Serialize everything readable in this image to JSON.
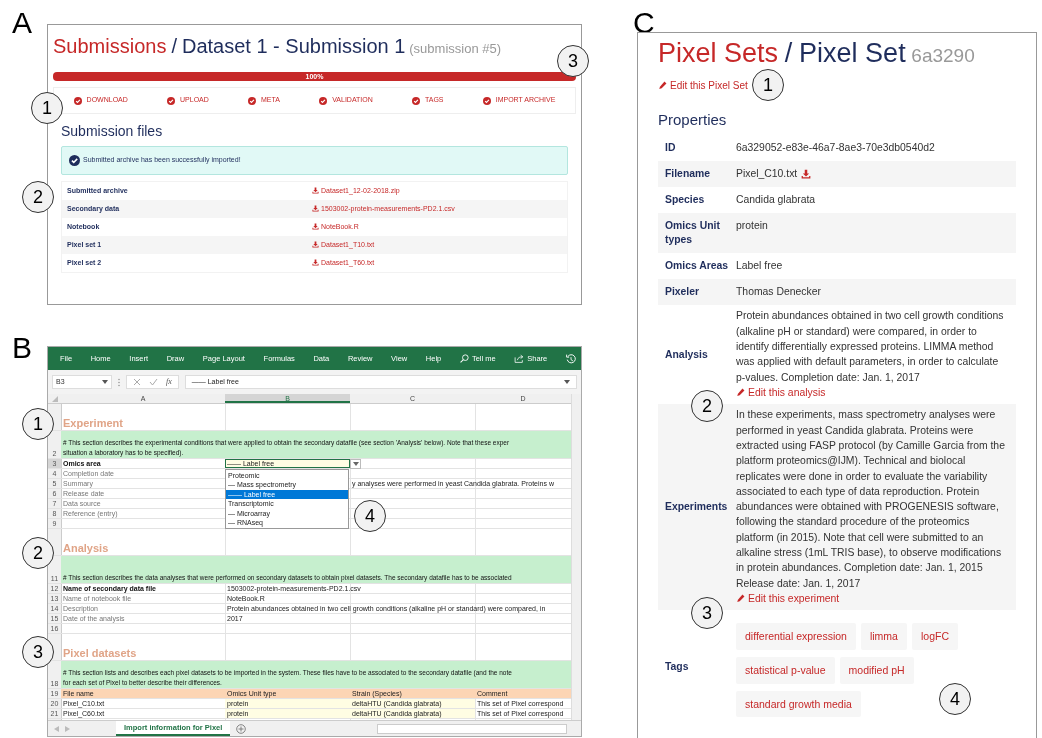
{
  "panel_a": {
    "letter": "A",
    "breadcrumb": "Submissions",
    "separator": "/",
    "title": "Dataset 1 - Submission 1",
    "subtitle": "(submission #5)",
    "progress": {
      "level": 1,
      "label": "100%"
    },
    "steps": [
      {
        "label": "DOWNLOAD",
        "done": true
      },
      {
        "label": "UPLOAD",
        "done": true
      },
      {
        "label": "META",
        "done": true
      },
      {
        "label": "VALIDATION",
        "done": true
      },
      {
        "label": "TAGS",
        "done": true
      },
      {
        "label": "IMPORT ARCHIVE",
        "done": true
      }
    ],
    "section_title": "Submission files",
    "alert": "Submitted archive has been successfully imported!",
    "files": [
      {
        "label": "Submitted archive",
        "file": "Dataset1_12-02-2018.zip"
      },
      {
        "label": "Secondary data",
        "file": "1503002-protein-measurements-PD2.1.csv"
      },
      {
        "label": "Notebook",
        "file": "NoteBook.R"
      },
      {
        "label": "Pixel set 1",
        "file": "Dataset1_T10.txt"
      },
      {
        "label": "Pixel set 2",
        "file": "Dataset1_T60.txt"
      }
    ],
    "callouts": [
      "1",
      "2",
      "3"
    ]
  },
  "panel_b": {
    "letter": "B",
    "ribbon_tabs": [
      "File",
      "Home",
      "Insert",
      "Draw",
      "Page Layout",
      "Formulas",
      "Data",
      "Review",
      "View",
      "Help"
    ],
    "tell_me": "Tell me",
    "share": "Share",
    "name_box": "B3",
    "fx": "fx",
    "formula": "—— Label free",
    "columns": [
      {
        "label": "A",
        "selected": false
      },
      {
        "label": "B",
        "selected": true
      },
      {
        "label": "C",
        "selected": false
      },
      {
        "label": "D",
        "selected": false
      }
    ],
    "rows": [
      {
        "kind": "section",
        "cells": [
          "Experiment"
        ]
      },
      {
        "kind": "note",
        "number": "2",
        "lines": [
          "# This section describes the experimental conditions that were applied to obtain the secondary datafile (see section 'Analysis' below). Note that these exper",
          "situation a laboratory has to be specified)."
        ]
      },
      {
        "kind": "field",
        "number": "3",
        "bold": true,
        "cells": [
          "Omics area"
        ],
        "dropdown": {
          "value": "—— Label free",
          "options": [
            {
              "label": "Proteomic",
              "selected": false
            },
            {
              "label": "— Mass spectrometry",
              "selected": false
            },
            {
              "label": "—— Label free",
              "selected": true
            },
            {
              "label": "Transcriptomic",
              "selected": false
            },
            {
              "label": "— Microarray",
              "selected": false
            },
            {
              "label": "— RNAseq",
              "selected": false
            }
          ]
        }
      },
      {
        "kind": "field",
        "number": "4",
        "bold": false,
        "cells": [
          "Completion date"
        ]
      },
      {
        "kind": "field",
        "number": "5",
        "bold": false,
        "cells": [
          "Summary",
          "",
          "y analyses were performed in yeast Candida glabrata. Proteins w"
        ]
      },
      {
        "kind": "field",
        "number": "6",
        "bold": false,
        "cells": [
          "Release date"
        ]
      },
      {
        "kind": "field",
        "number": "7",
        "bold": false,
        "cells": [
          "Data source"
        ]
      },
      {
        "kind": "field",
        "number": "8",
        "bold": false,
        "cells": [
          "Reference (entry)"
        ]
      },
      {
        "kind": "blank",
        "number": "9"
      },
      {
        "kind": "section",
        "cells": [
          "Analysis"
        ]
      },
      {
        "kind": "note",
        "number": "11",
        "lines": [
          "# This section describes the data analyses that were performed on secondary datasets to obtain pixel datasets. The secondary datafile has to be associated"
        ]
      },
      {
        "kind": "field",
        "number": "12",
        "bold": true,
        "cells": [
          "Name of secondary data file",
          "1503002-protein-measurements-PD2.1.csv"
        ]
      },
      {
        "kind": "field",
        "number": "13",
        "bold": false,
        "cells": [
          "Name of notebook file",
          "NoteBook.R"
        ]
      },
      {
        "kind": "field",
        "number": "14",
        "bold": false,
        "cells": [
          "Description",
          "Protein abundances obtained in two cell growth conditions (alkaline pH or standard) were compared, in"
        ]
      },
      {
        "kind": "field",
        "number": "15",
        "bold": false,
        "cells": [
          "Date of the analysis",
          "2017"
        ]
      },
      {
        "kind": "blank",
        "number": "16"
      },
      {
        "kind": "section",
        "cells": [
          "Pixel datasets"
        ]
      },
      {
        "kind": "note",
        "number": "18",
        "lines": [
          "# This section lists and describes each pixel datasets to be imported in the system. These files have to be associated to the secondary datafile (and the note",
          "for each set of Pixel to better describe their differences."
        ]
      },
      {
        "kind": "header",
        "number": "19",
        "cells": [
          "File name",
          "Omics Unit type",
          "Strain (Species)",
          "Comment"
        ]
      },
      {
        "kind": "data",
        "number": "20",
        "cells": [
          "Pixel_C10.txt",
          "protein",
          "deltaHTU (Candida glabrata)",
          "This set of Pixel correspond"
        ]
      },
      {
        "kind": "data",
        "number": "21",
        "cells": [
          "Pixel_C60.txt",
          "protein",
          "deltaHTU (Candida glabrata)",
          "This set of Pixel correspond"
        ]
      }
    ],
    "sheet_tab": "Import information for Pixel",
    "callouts": [
      "1",
      "2",
      "3",
      "4"
    ]
  },
  "panel_c": {
    "letter": "C",
    "breadcrumb": "Pixel Sets",
    "separator": "/",
    "title": "Pixel Set",
    "subtitle": "6a3290",
    "edit_link": "Edit this Pixel Set",
    "section_title": "Properties",
    "properties": [
      {
        "label": "ID",
        "value": "6a329052-e83e-46a7-8ae3-70e3db0540d2"
      },
      {
        "label": "Filename",
        "value": "Pixel_C10.txt",
        "download": true
      },
      {
        "label": "Species",
        "value": "Candida glabrata"
      },
      {
        "label": "Omics Unit types",
        "value": "protein"
      },
      {
        "label": "Omics Areas",
        "value": "Label free"
      },
      {
        "label": "Pixeler",
        "value": "Thomas Denecker"
      },
      {
        "label": "Analysis",
        "value": "Protein abundances obtained in two cell growth conditions (alkaline pH or standard) were compared, in order to identify differentially expressed proteins. LIMMA method was applied with default parameters, in order to calculate p-values. Completion date: Jan. 1, 2017",
        "edit_link": "Edit this analysis"
      },
      {
        "label": "Experiments",
        "value": "In these experiments, mass spectrometry analyses were performed in yeast Candida glabrata. Proteins were extracted using FASP protocol (by Camille Garcia from the platform proteomics@IJM). Technical and biolocal replicates were done in order to evaluate the variability associated to each type of data reproduction. Protein abundances were obtained with PROGENESIS software, following the standard procedure of the proteomics platform (in 2015). Note that cell were submitted to an alkaline stress (1mL TRIS base), to observe modifications in protein abundances. Completion date: Jan. 1, 2015 Release date: Jan. 1, 2017",
        "edit_link": "Edit this experiment"
      },
      {
        "label": "Tags",
        "tags": [
          "differential expression",
          "limma",
          "logFC",
          "statistical p-value",
          "modified pH",
          "standard growth media"
        ]
      }
    ],
    "callouts": [
      "1",
      "2",
      "3",
      "4"
    ]
  }
}
